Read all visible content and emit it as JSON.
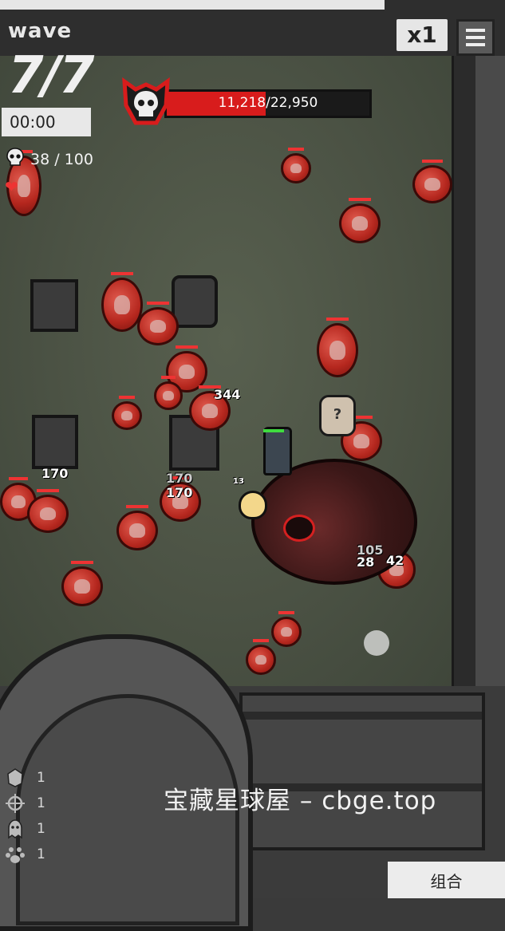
{
  "hud": {
    "wave_label": "wave",
    "wave_value": "7/7",
    "timer": "00:00",
    "kills": "38 / 100",
    "speed": "x1"
  },
  "boss": {
    "hp_text_current": "11,218",
    "hp_text_sep": "/",
    "hp_text_max": "22,950",
    "hp_fraction": 0.489
  },
  "damage_numbers": [
    "170",
    "170",
    "170",
    "344",
    "105",
    "28",
    "42",
    "13"
  ],
  "watermark": "宝藏星球屋 – cbge.top",
  "bottom_stats": [
    {
      "icon": "helmet-icon",
      "value": "1"
    },
    {
      "icon": "crosshair-icon",
      "value": "1"
    },
    {
      "icon": "ghost-icon",
      "value": "1"
    },
    {
      "icon": "paw-icon",
      "value": "1"
    }
  ],
  "combo_button": "组合",
  "colors": {
    "boss_bar": "#d81c1c",
    "enemy": "#c0392b",
    "player_hp": "#3fdc3f"
  }
}
